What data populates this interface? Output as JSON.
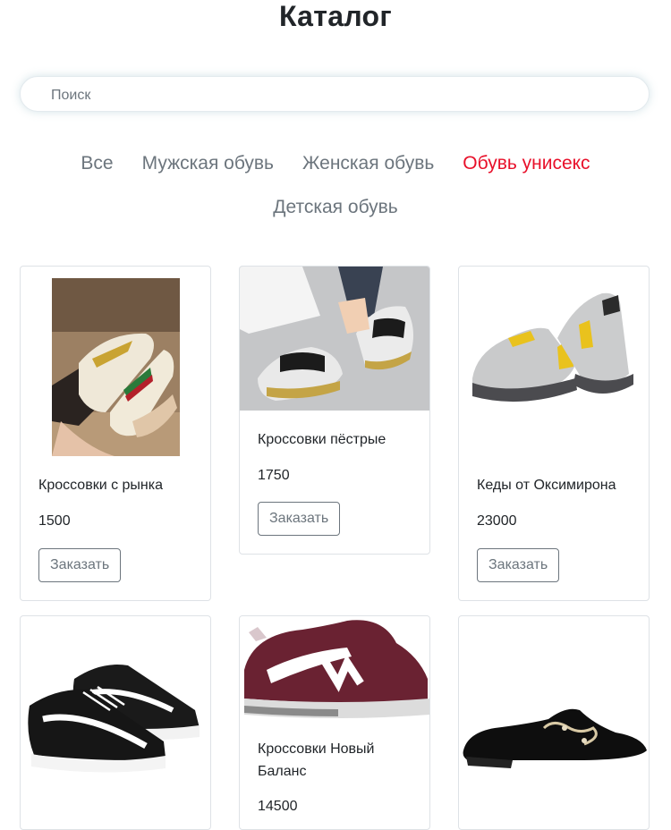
{
  "page": {
    "title": "Каталог"
  },
  "search": {
    "placeholder": "Поиск"
  },
  "filters": [
    {
      "label": "Все",
      "active": false
    },
    {
      "label": "Мужская обувь",
      "active": false
    },
    {
      "label": "Женская обувь",
      "active": false
    },
    {
      "label": "Обувь унисекс",
      "active": true
    },
    {
      "label": "Детская обувь",
      "active": false
    }
  ],
  "colors": {
    "accent": "#e8102a",
    "muted": "#6c757d",
    "border": "#dee2e6"
  },
  "products": [
    {
      "name": "Кроссовки с рынка",
      "price": "1500",
      "order_label": "Заказать"
    },
    {
      "name": "Кроссовки пёстрые",
      "price": "1750",
      "order_label": "Заказать"
    },
    {
      "name": "Кеды от Оксимирона",
      "price": "23000",
      "order_label": "Заказать"
    },
    {
      "name": "",
      "price": ""
    },
    {
      "name": "Кроссовки Новый Баланс",
      "price": "14500"
    },
    {
      "name": "",
      "price": ""
    }
  ]
}
